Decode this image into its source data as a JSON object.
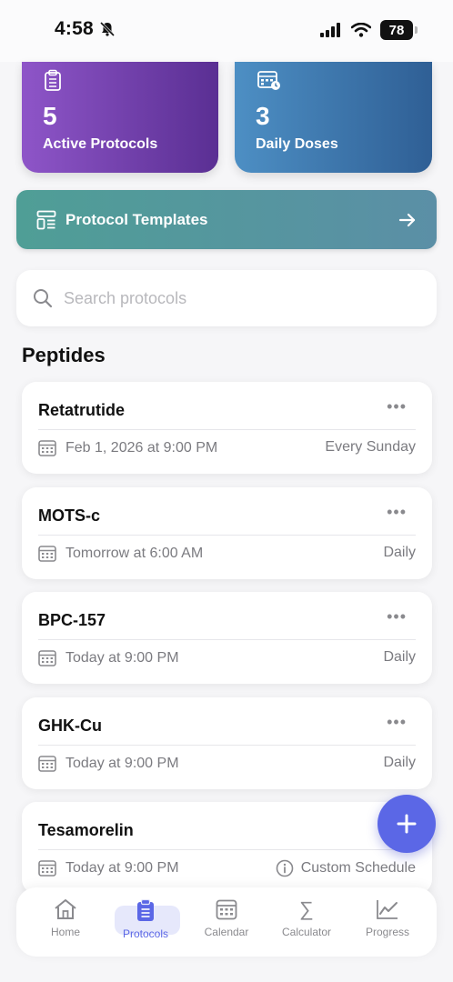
{
  "status_bar": {
    "time": "4:58",
    "battery": "78"
  },
  "stats": [
    {
      "value": "5",
      "label": "Active Protocols",
      "color": "#7b45b8",
      "icon": "clipboard-icon"
    },
    {
      "value": "3",
      "label": "Daily Doses",
      "color": "#3f78ad",
      "icon": "calendar-clock-icon"
    }
  ],
  "templates_banner": {
    "label": "Protocol Templates",
    "icon": "template-icon"
  },
  "search": {
    "placeholder": "Search protocols"
  },
  "section_title": "Peptides",
  "peptides": [
    {
      "name": "Retatrutide",
      "next_dose": "Feb 1, 2026 at 9:00 PM",
      "frequency": "Every Sunday"
    },
    {
      "name": "MOTS-c",
      "next_dose": "Tomorrow at 6:00 AM",
      "frequency": "Daily"
    },
    {
      "name": "BPC-157",
      "next_dose": "Today at 9:00 PM",
      "frequency": "Daily"
    },
    {
      "name": "GHK-Cu",
      "next_dose": "Today at 9:00 PM",
      "frequency": "Daily"
    },
    {
      "name": "Tesamorelin",
      "next_dose": "Today at 9:00 PM",
      "frequency": "Custom Schedule"
    }
  ],
  "nav": [
    {
      "label": "Home",
      "icon": "home-icon"
    },
    {
      "label": "Protocols",
      "icon": "clipboard-icon",
      "active": true
    },
    {
      "label": "Calendar",
      "icon": "calendar-icon"
    },
    {
      "label": "Calculator",
      "icon": "sigma-icon"
    },
    {
      "label": "Progress",
      "icon": "chart-line-icon"
    }
  ],
  "colors": {
    "accent": "#5b67e6",
    "teal": "#4f9e96"
  }
}
